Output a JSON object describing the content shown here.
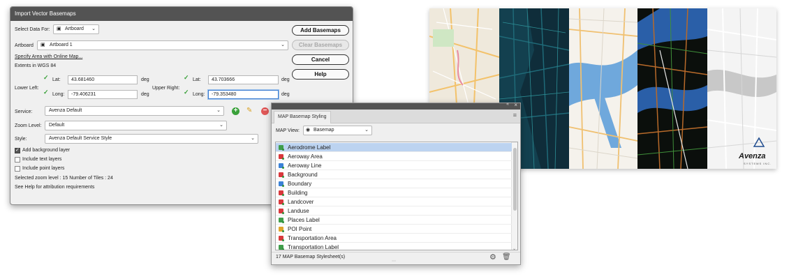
{
  "import_dialog": {
    "title": "Import Vector Basemaps",
    "select_data_for_label": "Select Data For:",
    "select_data_for_value": "Artboard",
    "artboard_label": "Artboard",
    "artboard_value": "Artboard 1",
    "specify_area_link": "Specify Area with Online Map...",
    "extents_label": "Extents in WGS 84",
    "lower_left_label": "Lower Left:",
    "upper_right_label": "Upper Right:",
    "lat_label": "Lat:",
    "long_label": "Long:",
    "deg_label": "deg",
    "lower_left_lat": "43.681460",
    "lower_left_long": "-79.406231",
    "upper_right_lat": "43.703666",
    "upper_right_long": "-79.353480",
    "service_label": "Service:",
    "service_value": "Avenza Default",
    "zoom_label": "Zoom Level:",
    "zoom_value": "Default",
    "style_label": "Style:",
    "style_value": "Avenza Default Service Style",
    "add_background_label": "Add background layer",
    "include_text_label": "Include text layers",
    "include_point_label": "Include point layers",
    "add_background_checked": true,
    "include_text_checked": false,
    "include_point_checked": false,
    "selected_zoom_text": "Selected zoom level : 15   Number of Tiles : 24",
    "help_attribution_text": "See Help for attribution requirements",
    "buttons": {
      "add": "Add Basemaps",
      "clear": "Clear Basemaps",
      "cancel": "Cancel",
      "help": "Help"
    }
  },
  "map_image": {
    "logo_text": "Avenza",
    "logo_sub": "SYSTEMS INC."
  },
  "styling_panel": {
    "tab_title": "MAP Basemap Styling",
    "map_view_label": "MAP View:",
    "map_view_value": "Basemap",
    "items": [
      {
        "label": "Aerodrome Label",
        "color": "#3f9d4a",
        "selected": true
      },
      {
        "label": "Aeroway Area",
        "color": "#d8383c",
        "selected": false
      },
      {
        "label": "Aeroway Line",
        "color": "#3b82d6",
        "selected": false
      },
      {
        "label": "Background",
        "color": "#d8383c",
        "selected": false
      },
      {
        "label": "Boundary",
        "color": "#3b82d6",
        "selected": false
      },
      {
        "label": "Building",
        "color": "#d8383c",
        "selected": false
      },
      {
        "label": "Landcover",
        "color": "#d8383c",
        "selected": false
      },
      {
        "label": "Landuse",
        "color": "#d8383c",
        "selected": false
      },
      {
        "label": "Places Label",
        "color": "#3f9d4a",
        "selected": false
      },
      {
        "label": "POI Point",
        "color": "#e0a52b",
        "selected": false
      },
      {
        "label": "Transportation Area",
        "color": "#d8383c",
        "selected": false
      },
      {
        "label": "Transportation Label",
        "color": "#3f9d4a",
        "selected": false
      }
    ],
    "footer_text": "17 MAP Basemap Stylesheet(s)"
  }
}
